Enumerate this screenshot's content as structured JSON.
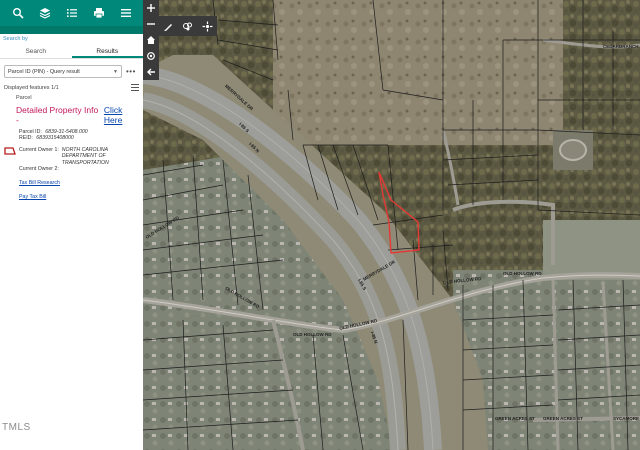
{
  "panel": {
    "toolbar": {
      "icons": [
        "search-icon",
        "layers-icon",
        "list-icon",
        "print-icon",
        "menu-icon"
      ],
      "color": "#00897b"
    },
    "search_by": "Search by",
    "tabs": [
      {
        "label": "Search",
        "active": false
      },
      {
        "label": "Results",
        "active": true
      }
    ],
    "query_select": {
      "value": "Parcel ID (PIN) - Query result"
    },
    "more_label": "•••",
    "displayed_features": "Displayed features 1/1",
    "result": {
      "layer": "Parcel",
      "detail_label": "Detailed Property Info -",
      "detail_link": "Click Here",
      "parcel_id_label": "Parcel ID:",
      "parcel_id_value": "6839-31-5408.000",
      "reid_label": "REID:",
      "reid_value": "6839315408000",
      "owner1_label": "Current Owner 1:",
      "owner1_value": "NORTH CAROLINA DEPARTMENT OF TRANSPORTATION",
      "owner2_label": "Current Owner 2:",
      "tax_bill_research": "Tax Bill Research",
      "pay_tax_bill": "Pay Tax Bill"
    }
  },
  "watermark": "TMLS",
  "map": {
    "left_tools": [
      "plus-icon",
      "minus-icon",
      "home-icon",
      "locate-icon",
      "back-arrow-icon"
    ],
    "top_tools": [
      "draw-icon",
      "measure-icon",
      "select-icon"
    ],
    "highlight_color": "#e53935",
    "road_labels": [
      {
        "text": "MERRYDALE DR"
      },
      {
        "text": "I-85 S"
      },
      {
        "text": "I-85 N"
      },
      {
        "text": "OLD HOLLOW RD"
      },
      {
        "text": "OLD HOLLOW RD"
      },
      {
        "text": "OLD HOLLOW RD"
      },
      {
        "text": "OLD HOLLOW RD"
      },
      {
        "text": "OLD HOLLOW RD"
      },
      {
        "text": "MERRYDALE DR"
      },
      {
        "text": "I-85 S"
      },
      {
        "text": "I-85 N"
      },
      {
        "text": "CEDARBRANCH"
      },
      {
        "text": "GREEN ACRES ST"
      },
      {
        "text": "GREEN ACRES ST"
      },
      {
        "text": "SYCAMORE"
      },
      {
        "text": "OLD HOLLOW RD"
      }
    ]
  }
}
